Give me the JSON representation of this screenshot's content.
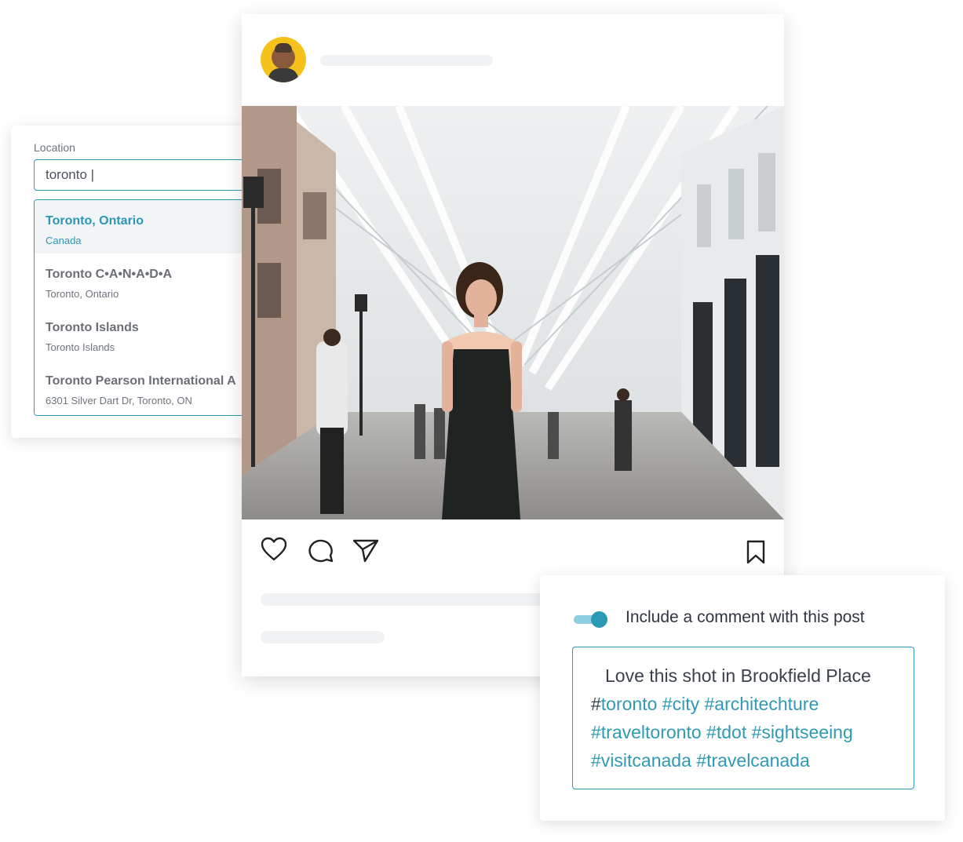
{
  "location": {
    "label": "Location",
    "input_value": "toronto |",
    "results": [
      {
        "title": "Toronto, Ontario",
        "subtitle": "Canada",
        "selected": true
      },
      {
        "title": "Toronto C•A•N•A•D•A",
        "subtitle": "Toronto, Ontario",
        "selected": false
      },
      {
        "title": "Toronto Islands",
        "subtitle": "Toronto Islands",
        "selected": false
      },
      {
        "title": "Toronto Pearson International A",
        "subtitle": "6301 Silver Dart Dr, Toronto, ON",
        "selected": false
      }
    ]
  },
  "post": {
    "icons": [
      "heart-icon",
      "comment-icon",
      "share-icon",
      "bookmark-icon"
    ]
  },
  "comment": {
    "toggle_on": true,
    "toggle_label": "Include a comment with this post",
    "text_line1": "Love this shot in Brookfield Place",
    "hashtags_line1": [
      "toronto",
      "city",
      "architechture"
    ],
    "hashtags_line2": [
      "traveltoronto",
      "tdot",
      "sightseeing"
    ],
    "hashtags_line3": [
      "visitcanada",
      "travelcanada"
    ]
  },
  "colors": {
    "accent": "#2f9ab3",
    "toggle_track": "#8fcde0",
    "placeholder": "#f0f2f4"
  }
}
